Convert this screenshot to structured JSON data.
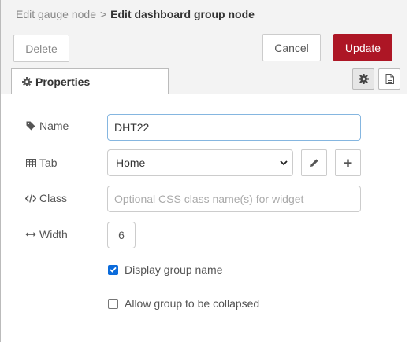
{
  "breadcrumb": {
    "previous": "Edit gauge node",
    "separator": ">",
    "current": "Edit dashboard group node"
  },
  "toolbar": {
    "delete_label": "Delete",
    "cancel_label": "Cancel",
    "update_label": "Update"
  },
  "tabs": {
    "properties_label": "Properties"
  },
  "form": {
    "name": {
      "label": "Name",
      "value": "DHT22"
    },
    "tab": {
      "label": "Tab",
      "selected": "Home"
    },
    "class": {
      "label": "Class",
      "placeholder": "Optional CSS class name(s) for widget",
      "value": ""
    },
    "width": {
      "label": "Width",
      "value": "6"
    },
    "display_group_name": {
      "label": "Display group name",
      "checked": true
    },
    "allow_collapse": {
      "label": "Allow group to be collapsed",
      "checked": false
    }
  },
  "colors": {
    "accent": "#ad1625",
    "checkbox": "#0b6bdb",
    "focus_border": "#85b6e0"
  },
  "icons": {
    "properties": "gear-icon",
    "name": "tag-icon",
    "tab": "table-icon",
    "class": "code-icon",
    "width": "arrows-h-icon",
    "edit": "pencil-icon",
    "add": "plus-icon",
    "settings_tab": "gear-icon",
    "description_tab": "file-text-icon"
  }
}
